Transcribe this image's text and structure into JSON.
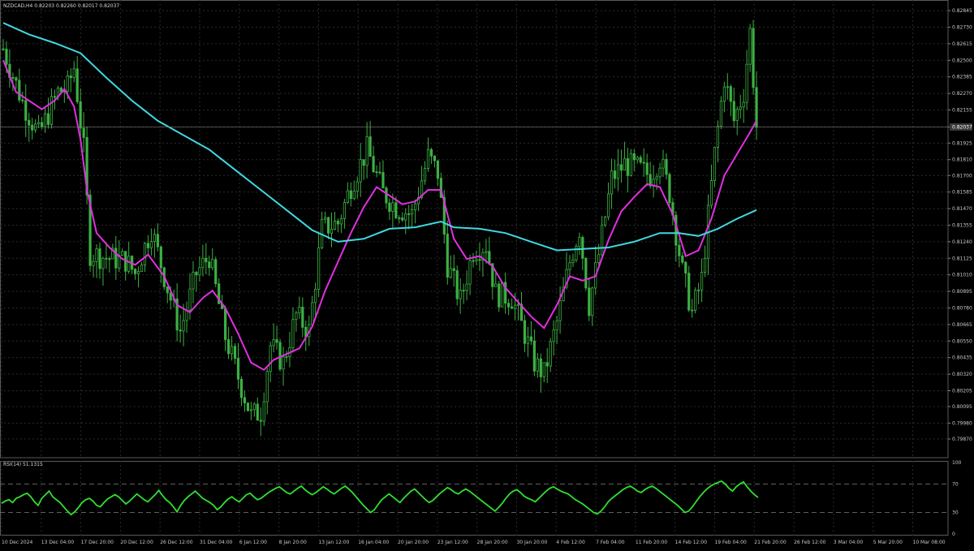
{
  "window": {
    "symbol_info": "NZDCAD,H4  0.82203 0.82260 0.82017 0.82037",
    "current_price": "0.82037"
  },
  "colors": {
    "background": "#000000",
    "grid": "#2a2a2a",
    "axis_text": "#c8c8c8",
    "candles": "#3cb043",
    "ma_fast": "#e030e0",
    "ma_slow": "#40d8e0",
    "rsi_line": "#30e030",
    "levels": "#808080"
  },
  "chart_data": [
    {
      "type": "candlestick",
      "title": "NZDCAD,H4  0.82203 0.82260 0.82017 0.82037",
      "ylim": [
        0.7974,
        0.8284
      ],
      "y_ticks": [
        "0.82845",
        "0.82730",
        "0.82615",
        "0.82500",
        "0.82385",
        "0.82270",
        "0.82155",
        "0.82037",
        "0.81925",
        "0.81810",
        "0.81700",
        "0.81585",
        "0.81470",
        "0.81355",
        "0.81240",
        "0.81125",
        "0.81010",
        "0.80895",
        "0.80780",
        "0.80665",
        "0.80550",
        "0.80435",
        "0.80320",
        "0.80205",
        "0.80095",
        "0.79980",
        "0.79870"
      ],
      "x_ticks": [
        "10 Dec 2024",
        "13 Dec 04:00",
        "17 Dec 20:00",
        "20 Dec 12:00",
        "26 Dec 12:00",
        "31 Dec 04:00",
        "6 Jan 12:00",
        "8 Jan 20:00",
        "13 Jan 12:00",
        "16 Jan 04:00",
        "20 Jan 20:00",
        "23 Jan 12:00",
        "28 Jan 20:00",
        "30 Jan 20:00",
        "4 Feb 12:00",
        "7 Feb 04:00",
        "11 Feb 20:00",
        "14 Feb 12:00",
        "19 Feb 04:00",
        "21 Feb 20:00",
        "26 Feb 12:00",
        "3 Mar 04:00",
        "5 Mar 20:00",
        "10 Mar 08:00"
      ],
      "price_anchors": [
        {
          "bar": 0,
          "close": 0.8258
        },
        {
          "bar": 6,
          "close": 0.8221
        },
        {
          "bar": 11,
          "close": 0.8198
        },
        {
          "bar": 17,
          "close": 0.8228
        },
        {
          "bar": 20,
          "close": 0.8231
        },
        {
          "bar": 22,
          "close": 0.8245
        },
        {
          "bar": 25,
          "close": 0.8188
        },
        {
          "bar": 27,
          "close": 0.8116
        },
        {
          "bar": 32,
          "close": 0.8113
        },
        {
          "bar": 38,
          "close": 0.8111
        },
        {
          "bar": 41,
          "close": 0.8102
        },
        {
          "bar": 46,
          "close": 0.8133
        },
        {
          "bar": 51,
          "close": 0.8092
        },
        {
          "bar": 55,
          "close": 0.8062
        },
        {
          "bar": 60,
          "close": 0.8102
        },
        {
          "bar": 64,
          "close": 0.8114
        },
        {
          "bar": 69,
          "close": 0.8058
        },
        {
          "bar": 73,
          "close": 0.803
        },
        {
          "bar": 77,
          "close": 0.8003
        },
        {
          "bar": 80,
          "close": 0.8006
        },
        {
          "bar": 83,
          "close": 0.8052
        },
        {
          "bar": 87,
          "close": 0.804
        },
        {
          "bar": 91,
          "close": 0.8073
        },
        {
          "bar": 95,
          "close": 0.8062
        },
        {
          "bar": 99,
          "close": 0.8133
        },
        {
          "bar": 104,
          "close": 0.8137
        },
        {
          "bar": 108,
          "close": 0.8163
        },
        {
          "bar": 113,
          "close": 0.8188
        },
        {
          "bar": 118,
          "close": 0.8158
        },
        {
          "bar": 122,
          "close": 0.8148
        },
        {
          "bar": 127,
          "close": 0.8143
        },
        {
          "bar": 132,
          "close": 0.8183
        },
        {
          "bar": 135,
          "close": 0.8172
        },
        {
          "bar": 138,
          "close": 0.8108
        },
        {
          "bar": 142,
          "close": 0.8083
        },
        {
          "bar": 146,
          "close": 0.8118
        },
        {
          "bar": 150,
          "close": 0.8122
        },
        {
          "bar": 153,
          "close": 0.8088
        },
        {
          "bar": 158,
          "close": 0.8085
        },
        {
          "bar": 162,
          "close": 0.806
        },
        {
          "bar": 165,
          "close": 0.804
        },
        {
          "bar": 168,
          "close": 0.8032
        },
        {
          "bar": 172,
          "close": 0.8068
        },
        {
          "bar": 176,
          "close": 0.811
        },
        {
          "bar": 179,
          "close": 0.8133
        },
        {
          "bar": 182,
          "close": 0.808
        },
        {
          "bar": 185,
          "close": 0.8115
        },
        {
          "bar": 189,
          "close": 0.8168
        },
        {
          "bar": 193,
          "close": 0.8178
        },
        {
          "bar": 197,
          "close": 0.8175
        },
        {
          "bar": 201,
          "close": 0.817
        },
        {
          "bar": 204,
          "close": 0.8182
        },
        {
          "bar": 207,
          "close": 0.8158
        },
        {
          "bar": 211,
          "close": 0.8103
        },
        {
          "bar": 214,
          "close": 0.8075
        },
        {
          "bar": 217,
          "close": 0.8098
        },
        {
          "bar": 221,
          "close": 0.8185
        },
        {
          "bar": 224,
          "close": 0.8238
        },
        {
          "bar": 227,
          "close": 0.8208
        },
        {
          "bar": 230,
          "close": 0.8228
        },
        {
          "bar": 232,
          "close": 0.827
        },
        {
          "bar": 234,
          "close": 0.8204
        }
      ],
      "indicators": [
        {
          "name": "MA fast",
          "color": "#e030e0",
          "points": [
            [
              0,
              0.825
            ],
            [
              4,
              0.8228
            ],
            [
              8,
              0.8222
            ],
            [
              12,
              0.8216
            ],
            [
              16,
              0.8222
            ],
            [
              19,
              0.823
            ],
            [
              22,
              0.8218
            ],
            [
              24,
              0.8195
            ],
            [
              26,
              0.816
            ],
            [
              29,
              0.813
            ],
            [
              33,
              0.812
            ],
            [
              37,
              0.8112
            ],
            [
              41,
              0.8108
            ],
            [
              45,
              0.8115
            ],
            [
              50,
              0.81
            ],
            [
              54,
              0.808
            ],
            [
              58,
              0.8075
            ],
            [
              62,
              0.8085
            ],
            [
              65,
              0.809
            ],
            [
              69,
              0.8078
            ],
            [
              73,
              0.806
            ],
            [
              77,
              0.804
            ],
            [
              81,
              0.8035
            ],
            [
              84,
              0.8042
            ],
            [
              88,
              0.8046
            ],
            [
              92,
              0.805
            ],
            [
              96,
              0.8065
            ],
            [
              100,
              0.809
            ],
            [
              104,
              0.811
            ],
            [
              108,
              0.813
            ],
            [
              112,
              0.8148
            ],
            [
              116,
              0.8162
            ],
            [
              120,
              0.8156
            ],
            [
              124,
              0.815
            ],
            [
              128,
              0.8152
            ],
            [
              132,
              0.816
            ],
            [
              136,
              0.816
            ],
            [
              140,
              0.8126
            ],
            [
              144,
              0.8112
            ],
            [
              148,
              0.8114
            ],
            [
              152,
              0.8107
            ],
            [
              156,
              0.8092
            ],
            [
              160,
              0.8082
            ],
            [
              164,
              0.8072
            ],
            [
              168,
              0.8064
            ],
            [
              172,
              0.808
            ],
            [
              176,
              0.81
            ],
            [
              180,
              0.8097
            ],
            [
              184,
              0.81
            ],
            [
              188,
              0.8125
            ],
            [
              192,
              0.8145
            ],
            [
              196,
              0.8155
            ],
            [
              200,
              0.8164
            ],
            [
              204,
              0.8162
            ],
            [
              208,
              0.8143
            ],
            [
              212,
              0.8114
            ],
            [
              216,
              0.8118
            ],
            [
              220,
              0.814
            ],
            [
              224,
              0.817
            ],
            [
              228,
              0.8185
            ],
            [
              232,
              0.82
            ],
            [
              234,
              0.8208
            ]
          ]
        },
        {
          "name": "MA slow",
          "color": "#40d8e0",
          "points": [
            [
              0,
              0.8276
            ],
            [
              8,
              0.8268
            ],
            [
              16,
              0.8262
            ],
            [
              24,
              0.8255
            ],
            [
              32,
              0.8238
            ],
            [
              40,
              0.8222
            ],
            [
              48,
              0.8208
            ],
            [
              56,
              0.8198
            ],
            [
              64,
              0.8188
            ],
            [
              72,
              0.8174
            ],
            [
              80,
              0.816
            ],
            [
              88,
              0.8146
            ],
            [
              96,
              0.8132
            ],
            [
              104,
              0.8124
            ],
            [
              112,
              0.8126
            ],
            [
              120,
              0.8133
            ],
            [
              128,
              0.8134
            ],
            [
              136,
              0.8138
            ],
            [
              140,
              0.8134
            ],
            [
              148,
              0.8133
            ],
            [
              156,
              0.813
            ],
            [
              164,
              0.8124
            ],
            [
              172,
              0.8118
            ],
            [
              180,
              0.8119
            ],
            [
              188,
              0.812
            ],
            [
              196,
              0.8124
            ],
            [
              204,
              0.813
            ],
            [
              210,
              0.813
            ],
            [
              216,
              0.8128
            ],
            [
              222,
              0.8133
            ],
            [
              228,
              0.814
            ],
            [
              234,
              0.8146
            ]
          ]
        }
      ]
    },
    {
      "type": "line",
      "title": "RSI(14) 51.1315",
      "ylim": [
        0,
        100
      ],
      "y_ticks": [
        "100",
        "70",
        "30",
        "0"
      ],
      "levels": [
        70,
        30
      ],
      "series": [
        {
          "name": "RSI(14)",
          "values": [
            43,
            46,
            48,
            44,
            50,
            52,
            55,
            57,
            52,
            45,
            40,
            50,
            55,
            60,
            52,
            48,
            44,
            38,
            32,
            27,
            31,
            37,
            44,
            48,
            50,
            46,
            40,
            38,
            44,
            49,
            52,
            55,
            52,
            47,
            42,
            46,
            51,
            56,
            52,
            48,
            45,
            50,
            55,
            61,
            54,
            48,
            44,
            38,
            31,
            40,
            47,
            52,
            56,
            60,
            55,
            50,
            47,
            44,
            40,
            34,
            38,
            44,
            49,
            52,
            48,
            45,
            50,
            55,
            57,
            52,
            48,
            50,
            54,
            58,
            61,
            64,
            66,
            62,
            58,
            56,
            60,
            64,
            67,
            62,
            58,
            55,
            58,
            62,
            66,
            63,
            59,
            56,
            60,
            64,
            67,
            63,
            58,
            52,
            46,
            40,
            35,
            30,
            34,
            41,
            48,
            52,
            56,
            52,
            48,
            44,
            50,
            55,
            60,
            63,
            58,
            53,
            48,
            44,
            47,
            52,
            57,
            61,
            65,
            62,
            58,
            56,
            60,
            63,
            60,
            56,
            52,
            48,
            44,
            40,
            36,
            32,
            37,
            43,
            50,
            56,
            60,
            62,
            58,
            53,
            50,
            48,
            45,
            50,
            55,
            60,
            64,
            66,
            63,
            60,
            58,
            56,
            52,
            48,
            45,
            42,
            38,
            34,
            30,
            28,
            32,
            38,
            45,
            50,
            54,
            58,
            62,
            65,
            67,
            64,
            60,
            58,
            62,
            65,
            67,
            64,
            60,
            56,
            52,
            48,
            44,
            40,
            35,
            30,
            32,
            38,
            45,
            52,
            58,
            63,
            67,
            70,
            72,
            74,
            70,
            64,
            60,
            66,
            70,
            73,
            66,
            60,
            55,
            51
          ]
        }
      ]
    }
  ]
}
